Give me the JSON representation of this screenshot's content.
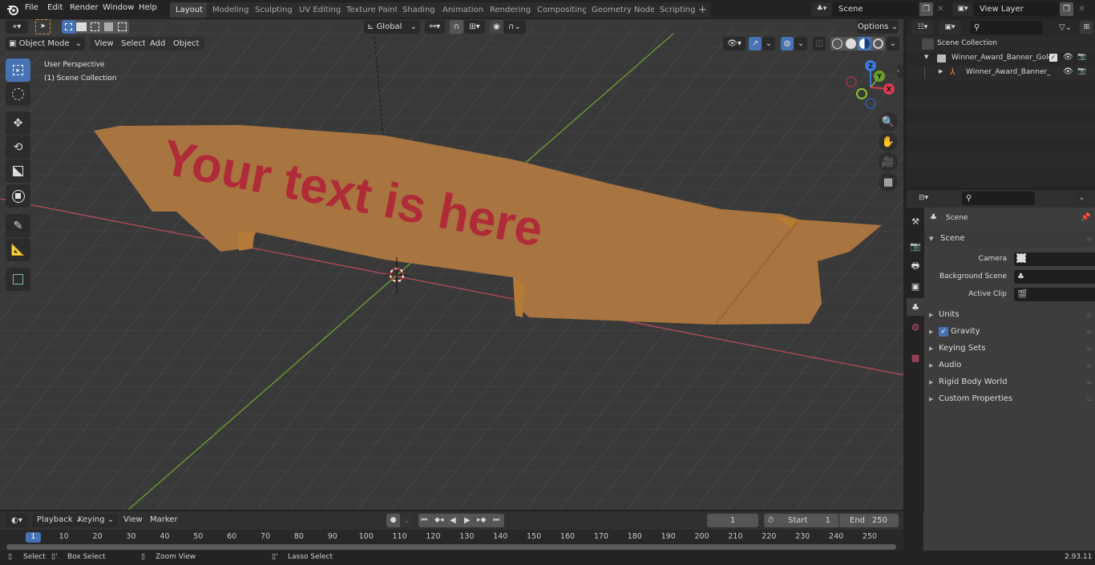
{
  "topbar": {
    "menus": [
      "File",
      "Edit",
      "Render",
      "Window",
      "Help"
    ],
    "workspaces": [
      "Layout",
      "Modeling",
      "Sculpting",
      "UV Editing",
      "Texture Paint",
      "Shading",
      "Animation",
      "Rendering",
      "Compositing",
      "Geometry Nodes",
      "Scripting"
    ],
    "active_workspace": "Layout",
    "add_workspace": "+",
    "scene_name": "Scene",
    "view_layer_name": "View Layer"
  },
  "viewport": {
    "mode": "Object Mode",
    "menus": [
      "View",
      "Select",
      "Add",
      "Object"
    ],
    "transform_orientation": "Global",
    "options_label": "Options",
    "perspective_label": "User Perspective",
    "collection_label": "(1) Scene Collection",
    "banner_text": "Your text is here",
    "gizmo_axes": {
      "x": "X",
      "y": "Y",
      "z": "Z"
    },
    "colors": {
      "banner": "#a87440",
      "banner_text": "#b02238",
      "x_axis": "#c84a5a",
      "y_axis": "#6a9a30",
      "grid_bg": "#393939"
    },
    "tools": [
      "select-box",
      "cursor",
      "move",
      "rotate",
      "scale",
      "transform",
      "annotate",
      "measure",
      "add-cube"
    ]
  },
  "outliner": {
    "search_placeholder": "",
    "root": "Scene Collection",
    "items": [
      {
        "label": "Winner_Award_Banner_Gold_",
        "type": "collection",
        "expanded": true,
        "checked": true
      },
      {
        "label": "Winner_Award_Banner_C",
        "type": "armature",
        "expanded": false
      }
    ]
  },
  "properties": {
    "context_title": "Scene",
    "panel_title": "Scene",
    "fields": [
      {
        "label": "Camera",
        "value": ""
      },
      {
        "label": "Background Scene",
        "value": ""
      },
      {
        "label": "Active Clip",
        "value": ""
      }
    ],
    "subpanels": [
      {
        "label": "Units"
      },
      {
        "label": "Gravity",
        "checkbox": true
      },
      {
        "label": "Keying Sets"
      },
      {
        "label": "Audio"
      },
      {
        "label": "Rigid Body World"
      },
      {
        "label": "Custom Properties"
      }
    ]
  },
  "timeline": {
    "menus": [
      "Playback",
      "Keying",
      "View",
      "Marker"
    ],
    "current_frame": "1",
    "start_label": "Start",
    "start": "1",
    "end_label": "End",
    "end": "250",
    "ticks": [
      "10",
      "20",
      "30",
      "40",
      "50",
      "60",
      "70",
      "80",
      "90",
      "100",
      "110",
      "120",
      "130",
      "140",
      "150",
      "160",
      "170",
      "180",
      "190",
      "200",
      "210",
      "220",
      "230",
      "240",
      "250"
    ],
    "playhead": "1"
  },
  "statusbar": {
    "select": "Select",
    "box_select": "Box Select",
    "zoom_view": "Zoom View",
    "lasso_select": "Lasso Select",
    "version": "2.93.11"
  }
}
